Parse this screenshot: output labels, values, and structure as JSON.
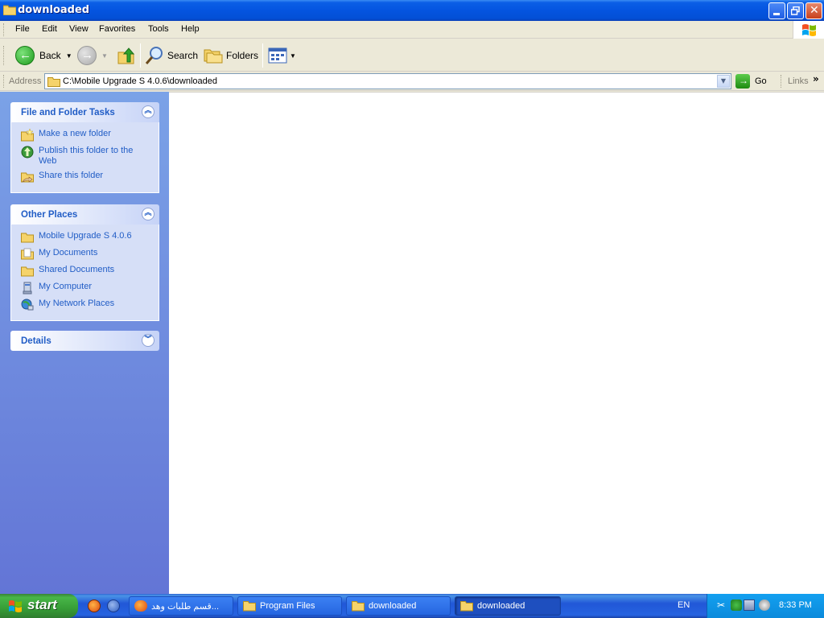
{
  "window": {
    "title": "downloaded"
  },
  "menu": {
    "items": [
      "File",
      "Edit",
      "View",
      "Favorites",
      "Tools",
      "Help"
    ]
  },
  "toolbar": {
    "back_label": "Back",
    "search_label": "Search",
    "folders_label": "Folders"
  },
  "address": {
    "label": "Address",
    "value": "C:\\Mobile Upgrade S 4.0.6\\downloaded",
    "go_label": "Go",
    "links_label": "Links"
  },
  "panels": {
    "tasks": {
      "title": "File and Folder Tasks",
      "items": [
        "Make a new folder",
        "Publish this folder to the Web",
        "Share this folder"
      ]
    },
    "places": {
      "title": "Other Places",
      "items": [
        "Mobile Upgrade S 4.0.6",
        "My Documents",
        "Shared Documents",
        "My Computer",
        "My Network Places"
      ]
    },
    "details": {
      "title": "Details"
    }
  },
  "taskbar": {
    "start_label": "start",
    "buttons": [
      "قسم طلبات وهد...",
      "Program Files",
      "downloaded",
      "downloaded"
    ],
    "language": "EN",
    "clock": "8:33 PM"
  },
  "colors": {
    "title_blue": "#0454e0",
    "task_link": "#215dc6",
    "left_pane_top": "#7ba2e7",
    "left_pane_bottom": "#6375d6",
    "start_green": "#379e37",
    "tray_blue": "#0c8adb"
  }
}
